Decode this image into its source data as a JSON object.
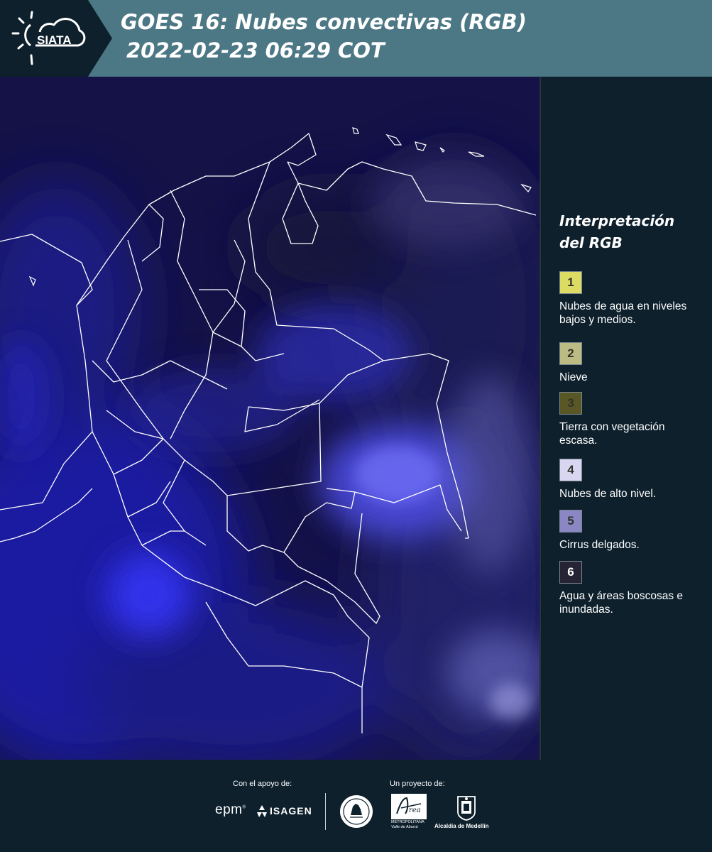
{
  "header": {
    "title_line1": "GOES 16: Nubes convectivas (RGB)",
    "title_line2": "2022-02-23 06:29 COT",
    "logo_text": "SIATA",
    "logo_icon": "sun-cloud-icon"
  },
  "map": {
    "alt": "Imagen satelital RGB de nubes convectivas sobre Colombia"
  },
  "legend": {
    "title_line1": "Interpretación",
    "title_line2": "del RGB",
    "items": [
      {
        "number": "1",
        "color": "#dcdc64",
        "label": "Nubes de agua en niveles bajos y medios."
      },
      {
        "number": "2",
        "color": "#bdbb84",
        "label": "Nieve"
      },
      {
        "number": "3",
        "color": "#585725",
        "label": "Tierra con vegetación escasa."
      },
      {
        "number": "4",
        "color": "#d8d6f0",
        "label": "Nubes de alto nivel."
      },
      {
        "number": "5",
        "color": "#8a87c4",
        "label": "Cirrus delgados."
      },
      {
        "number": "6",
        "color": "#262335",
        "label": "Agua y áreas boscosas e inundadas."
      }
    ]
  },
  "footer": {
    "support_label": "Con el apoyo de:",
    "project_label": "Un proyecto de:",
    "sponsor_epm": "epm",
    "sponsor_isagen": "ISAGEN",
    "partner_area_line1": "METROPOLITANA",
    "partner_area_line2": "Valle de Aburrá",
    "partner_alcaldia": "Alcaldía de Medellín"
  }
}
